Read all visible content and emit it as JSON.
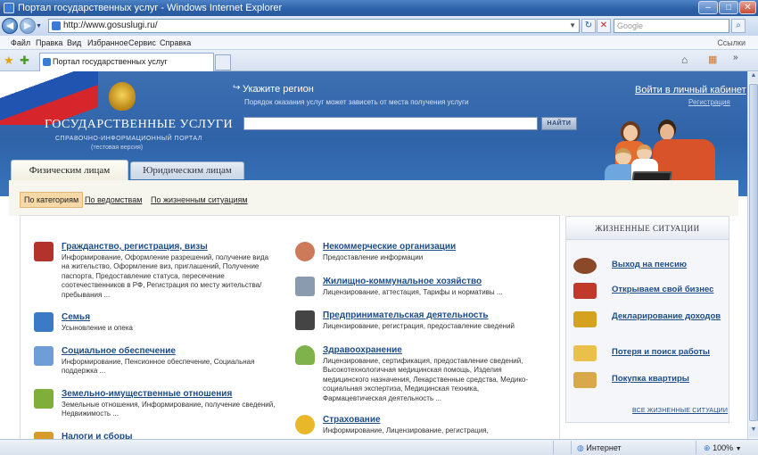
{
  "window": {
    "title": "Портал государственных услуг - Windows Internet Explorer",
    "address": "http://www.gosuslugi.ru/",
    "search_placeholder": "Google"
  },
  "menu": [
    "Файл",
    "Правка",
    "Вид",
    "Избранное",
    "Сервис",
    "Справка"
  ],
  "links_label": "Ссылки",
  "tab_label": "Портал государственных услуг",
  "header": {
    "title": "ГОСУДАРСТВЕННЫЕ УСЛУГИ",
    "subtitle": "СПРАВОЧНО-ИНФОРМАЦИОННЫЙ ПОРТАЛ",
    "test": "(тестовая версия)",
    "region_link": "Укажите регион",
    "region_note": "Порядок оказания услуг может зависеть от места получения услуги",
    "search_button": "НАЙТИ",
    "login": "Войти в личный кабинет",
    "register": "Регистрация"
  },
  "user_tabs": [
    "Физическим лицам",
    "Юридическим лицам"
  ],
  "sub_tabs": [
    "По категориям",
    "По ведомствам",
    "По жизненным ситуациям"
  ],
  "categories_left": [
    {
      "title": "Гражданство, регистрация, визы",
      "desc": "Информирование, Оформление разрешений, получение вида на жительство, Оформление виз, приглашений, Получение паспорта, Предоставление статуса, пересечение соотечественников в РФ, Регистрация по месту жительства/пребывания ...",
      "color": "#b3322c"
    },
    {
      "title": "Семья",
      "desc": "Усыновление и опека",
      "color": "#3b7bc6"
    },
    {
      "title": "Социальное обеспечение",
      "desc": "Информирование, Пенсионное обеспечение, Социальная поддержка ...",
      "color": "#6f9ed6"
    },
    {
      "title": "Земельно-имущественные отношения",
      "desc": "Земельные отношения, Информирование, получение сведений, Недвижимость ...",
      "color": "#7fae3a"
    },
    {
      "title": "Налоги и сборы",
      "desc": "",
      "color": "#d79b2a"
    }
  ],
  "categories_right": [
    {
      "title": "Некоммерческие организации",
      "desc": "Предоставление информации",
      "color": "#cc7a5a"
    },
    {
      "title": "Жилищно-коммунальное хозяйство",
      "desc": "Лицензирование, аттестация, Тарифы и нормативы ...",
      "color": "#8a9bb0"
    },
    {
      "title": "Предпринимательская деятельность",
      "desc": "Лицензирование, регистрация, предоставление сведений",
      "color": "#444444"
    },
    {
      "title": "Здравоохранение",
      "desc": "Лицензирование, сертификация, предоставление сведений, Высокотехнологичная медицинская помощь, Изделия медицинского назначения, Лекарственные средства, Медико-социальная экспертиза, Медицинская техника, Фармацевтическая деятельность ...",
      "color": "#7fb24a"
    },
    {
      "title": "Страхование",
      "desc": "Информирование, Лицензирование, регистрация,",
      "color": "#e8b82a"
    }
  ],
  "life_panel": {
    "title": "ЖИЗНЕННЫЕ СИТУАЦИИ",
    "items": [
      {
        "label": "Выход на пенсию",
        "color": "#8a4a2a"
      },
      {
        "label": "Открываем свой бизнес",
        "color": "#c0392b"
      },
      {
        "label": "Декларирование доходов",
        "color": "#d4a21f"
      },
      {
        "label": "Потеря и поиск работы",
        "color": "#e8c04a"
      },
      {
        "label": "Покупка квартиры",
        "color": "#d8a84a"
      }
    ],
    "all_link": "ВСЕ ЖИЗНЕННЫЕ СИТУАЦИИ"
  },
  "status": {
    "zone": "Интернет",
    "zoom": "100%"
  }
}
